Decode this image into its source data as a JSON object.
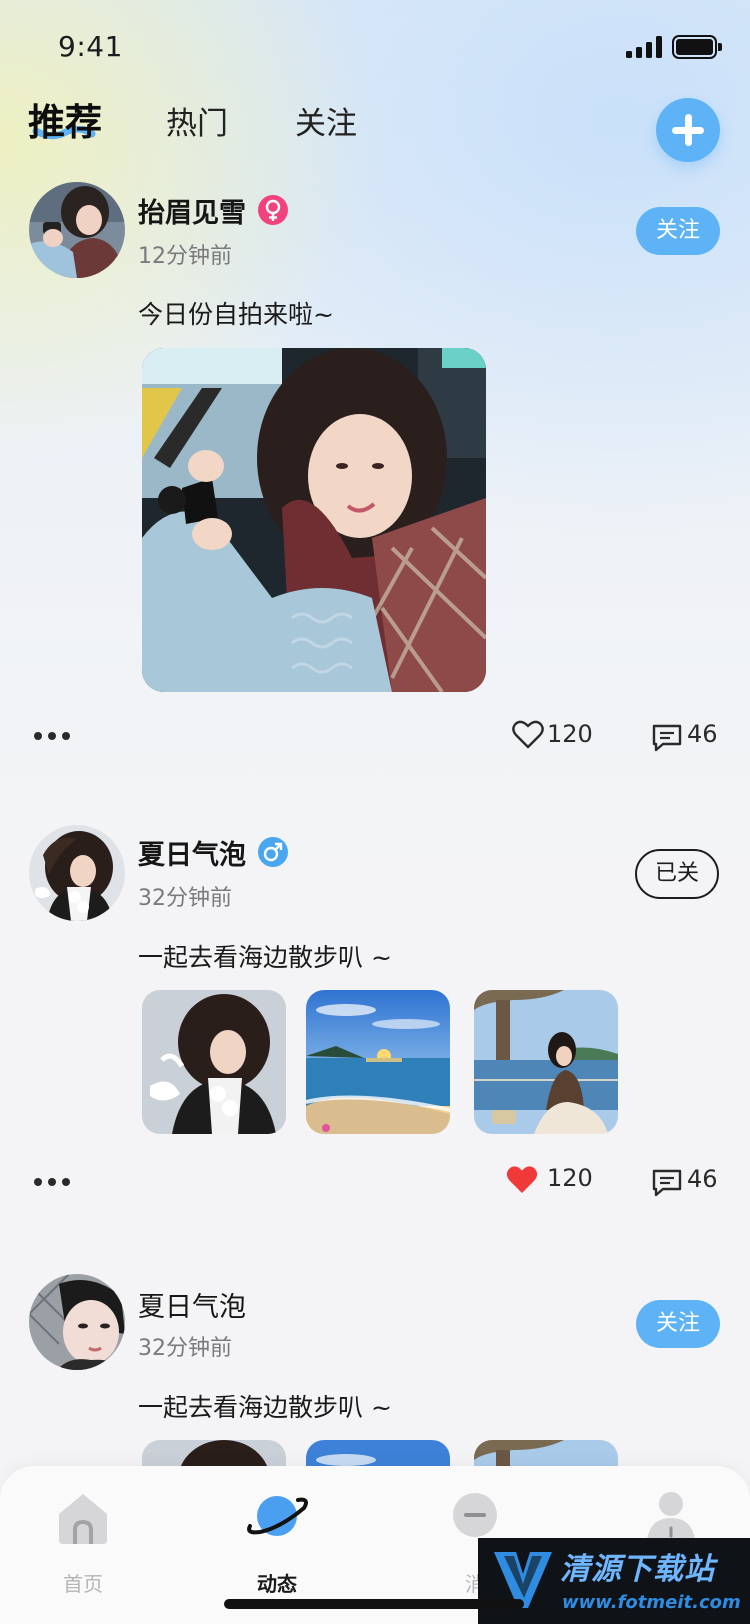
{
  "status": {
    "time": "9:41"
  },
  "tabs": {
    "recommend": "推荐",
    "hot": "热门",
    "follow": "关注"
  },
  "posts": [
    {
      "username": "抬眉见雪",
      "gender": "female",
      "time": "12分钟前",
      "text": "今日份自拍来啦~",
      "follow_label": "关注",
      "likes": "120",
      "liked": false,
      "comments": "46"
    },
    {
      "username": "夏日气泡",
      "gender": "male",
      "time": "32分钟前",
      "text": "一起去看海边散步叭 ~",
      "follow_label": "已关",
      "likes": "120",
      "liked": true,
      "comments": "46"
    },
    {
      "username": "夏日气泡",
      "time": "32分钟前",
      "text": "一起去看海边散步叭 ~",
      "follow_label": "关注"
    }
  ],
  "nav": {
    "home": "首页",
    "feed": "动态",
    "messages": "消",
    "profile": ""
  },
  "watermark": {
    "title": "清源下载站",
    "url": "www.fotmeit.com"
  },
  "colors": {
    "accent": "#5db3f5",
    "female": "#f0437d",
    "male": "#4aa6ee",
    "like_active": "#f03a3a"
  }
}
